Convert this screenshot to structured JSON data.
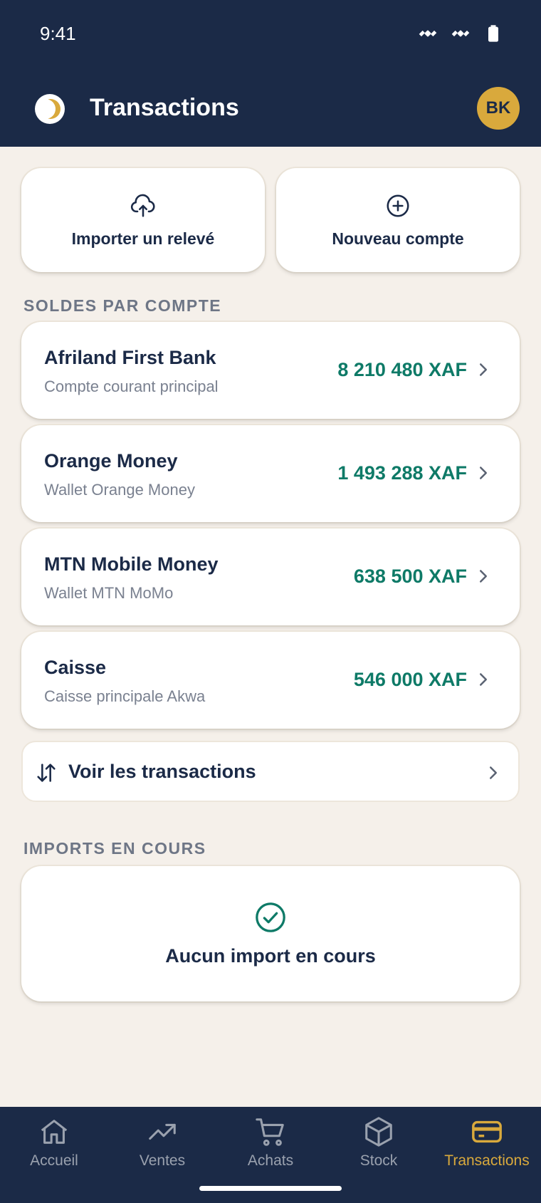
{
  "status_bar": {
    "time": "9:41",
    "icons": [
      "satellite-icon",
      "satellite-icon",
      "battery-icon"
    ]
  },
  "app_bar": {
    "title": "Transactions",
    "avatar_initials": "BK",
    "logo_icon": "half-moon-logo-icon"
  },
  "actions": [
    {
      "label": "Importer un relevé",
      "icon": "cloud-upload-icon"
    },
    {
      "label": "Nouveau compte",
      "icon": "plus-circle-icon"
    }
  ],
  "sections": {
    "balances": "SOLDES PAR COMPTE",
    "imports": "IMPORTS EN COURS"
  },
  "accounts": [
    {
      "name": "Afriland First Bank",
      "subtitle": "Compte courant principal",
      "amount": "8 210 480 XAF"
    },
    {
      "name": "Orange Money",
      "subtitle": "Wallet Orange Money",
      "amount": "1 493 288 XAF"
    },
    {
      "name": "MTN Mobile Money",
      "subtitle": "Wallet MTN MoMo",
      "amount": "638 500 XAF"
    },
    {
      "name": "Caisse",
      "subtitle": "Caisse principale Akwa",
      "amount": "546 000 XAF"
    }
  ],
  "transactions_link": {
    "label": "Voir les transactions",
    "icon": "swap-vertical-icon"
  },
  "imports": {
    "empty_label": "Aucun import en cours",
    "icon": "check-circle-icon"
  },
  "bottom_nav": [
    {
      "label": "Accueil",
      "icon": "home-icon",
      "active": false
    },
    {
      "label": "Ventes",
      "icon": "trend-up-icon",
      "active": false
    },
    {
      "label": "Achats",
      "icon": "cart-icon",
      "active": false
    },
    {
      "label": "Stock",
      "icon": "box-icon",
      "active": false
    },
    {
      "label": "Transactions",
      "icon": "card-icon",
      "active": true
    }
  ],
  "colors": {
    "header_bg": "#1B2A47",
    "page_bg": "#F5F0EA",
    "accent_gold": "#D9A93C",
    "amount_green": "#0E7A67",
    "muted_text": "#7A8190"
  }
}
